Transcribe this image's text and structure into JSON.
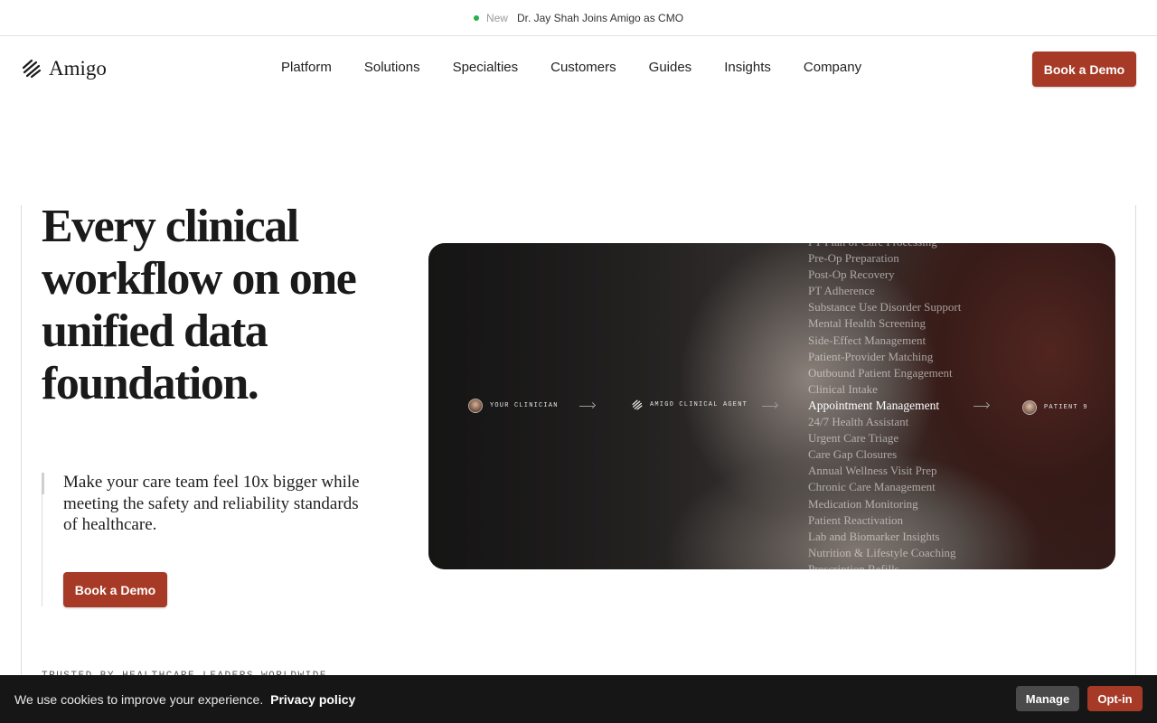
{
  "announcement": {
    "tag": "New",
    "message": "Dr. Jay Shah Joins Amigo as CMO"
  },
  "header": {
    "brand": "Amigo",
    "nav": [
      "Platform",
      "Solutions",
      "Specialties",
      "Customers",
      "Guides",
      "Insights",
      "Company"
    ],
    "cta_label": "Book a Demo"
  },
  "hero": {
    "title": "Every clinical workflow on one unified data foundation.",
    "subtitle": "Make your care team feel 10x bigger while meeting the safety and reliability standards of healthcare.",
    "cta_label": "Book a Demo",
    "trusted_label": "TRUSTED BY HEALTHCARE LEADERS WORLDWIDE"
  },
  "media": {
    "clinician_label": "YOUR CLINICIAN",
    "agent_label": "AMIGO CLINICAL AGENT",
    "patient_label": "PATIENT 9",
    "workflows": [
      "PT Plan of Care Processing",
      "Pre-Op Preparation",
      "Post-Op Recovery",
      "PT Adherence",
      "Substance Use Disorder Support",
      "Mental Health Screening",
      "Side-Effect Management",
      "Patient-Provider Matching",
      "Outbound Patient Engagement",
      "Clinical Intake",
      "Appointment Management",
      "24/7 Health Assistant",
      "Urgent Care Triage",
      "Care Gap Closures",
      "Annual Wellness Visit Prep",
      "Chronic Care Management",
      "Medication Monitoring",
      "Patient Reactivation",
      "Lab and Biomarker Insights",
      "Nutrition & Lifestyle Coaching",
      "Prescription Refills"
    ],
    "active_workflow": "Appointment Management"
  },
  "cookie_banner": {
    "text": "We use cookies to improve your experience.",
    "policy_link": "Privacy policy",
    "manage_label": "Manage",
    "optin_label": "Opt-in"
  },
  "colors": {
    "accent": "#a63a26",
    "status_dot": "#22b14c",
    "cookie_bg": "#161616"
  }
}
